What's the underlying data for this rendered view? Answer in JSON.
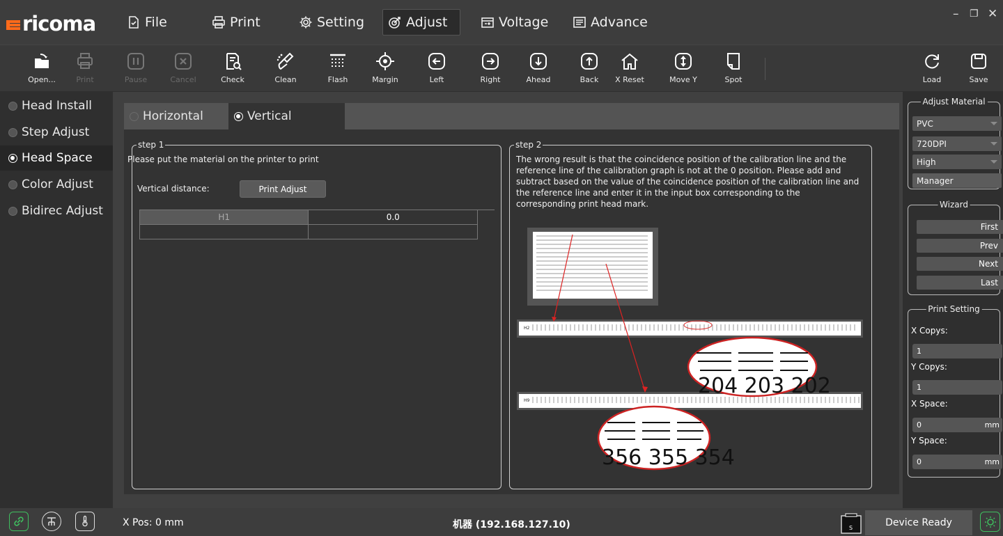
{
  "app": {
    "logo_text": "ricoma"
  },
  "menu": {
    "file": "File",
    "print": "Print",
    "setting": "Setting",
    "adjust": "Adjust",
    "voltage": "Voltage",
    "advance": "Advance"
  },
  "window": {
    "minimize": "–",
    "restore": "❐",
    "close": "✕"
  },
  "toolbar": {
    "open": "Open...",
    "print": "Print",
    "pause": "Pause",
    "cancel": "Cancel",
    "check": "Check",
    "clean": "Clean",
    "flash": "Flash",
    "margin": "Margin",
    "left": "Left",
    "right": "Right",
    "ahead": "Ahead",
    "back": "Back",
    "x_reset": "X Reset",
    "move_y": "Move Y",
    "spot": "Spot",
    "load": "Load",
    "save": "Save"
  },
  "nav": {
    "items": [
      {
        "label": "Head Install"
      },
      {
        "label": "Step Adjust"
      },
      {
        "label": "Head Space"
      },
      {
        "label": "Color Adjust"
      },
      {
        "label": "Bidirec Adjust"
      }
    ],
    "selected": "Head Space"
  },
  "subtabs": {
    "horizontal": "Horizontal",
    "vertical": "Vertical",
    "selected": "Vertical"
  },
  "step1": {
    "title": "step 1",
    "instruction": "Please put the material on the printer to print",
    "distance_label": "Vertical distance:",
    "print_adjust": "Print Adjust",
    "table": {
      "head": "H1",
      "value": "0.0"
    }
  },
  "step2": {
    "title": "step 2",
    "lines": [
      "The wrong result is that the coincidence position of the calibration line and the",
      "reference line of the calibration graph is not at the 0 position. Please add and",
      "subtract based on the value of the coincidence position of the calibration line and",
      "the reference line and enter it in the input box corresponding to the",
      "corresponding print head mark."
    ],
    "strip1_label": "H2",
    "strip2_label": "H9",
    "zoom1": "204 203 202",
    "zoom2": "356 355 354"
  },
  "adjust_material": {
    "title": "Adjust Material",
    "material": "PVC",
    "resolution": "720DPI",
    "quality": "High",
    "manager": "Manager"
  },
  "wizard": {
    "title": "Wizard",
    "first": "First",
    "prev": "Prev",
    "next": "Next",
    "last": "Last"
  },
  "print_setting": {
    "title": "Print Setting",
    "x_copys_label": "X Copys:",
    "x_copys": "1",
    "y_copys_label": "Y Copys:",
    "y_copys": "1",
    "x_space_label": "X Space:",
    "x_space": "0",
    "y_space_label": "Y Space:",
    "y_space": "0",
    "unit": "mm"
  },
  "status": {
    "x_pos": "X Pos: 0 mm",
    "machine": "机器 (192.168.127.10)",
    "ink_letter": "S",
    "device_state": "Device Ready"
  },
  "colors": {
    "accent_green": "#3fbf5f",
    "brand_orange": "#ff6a1a"
  }
}
